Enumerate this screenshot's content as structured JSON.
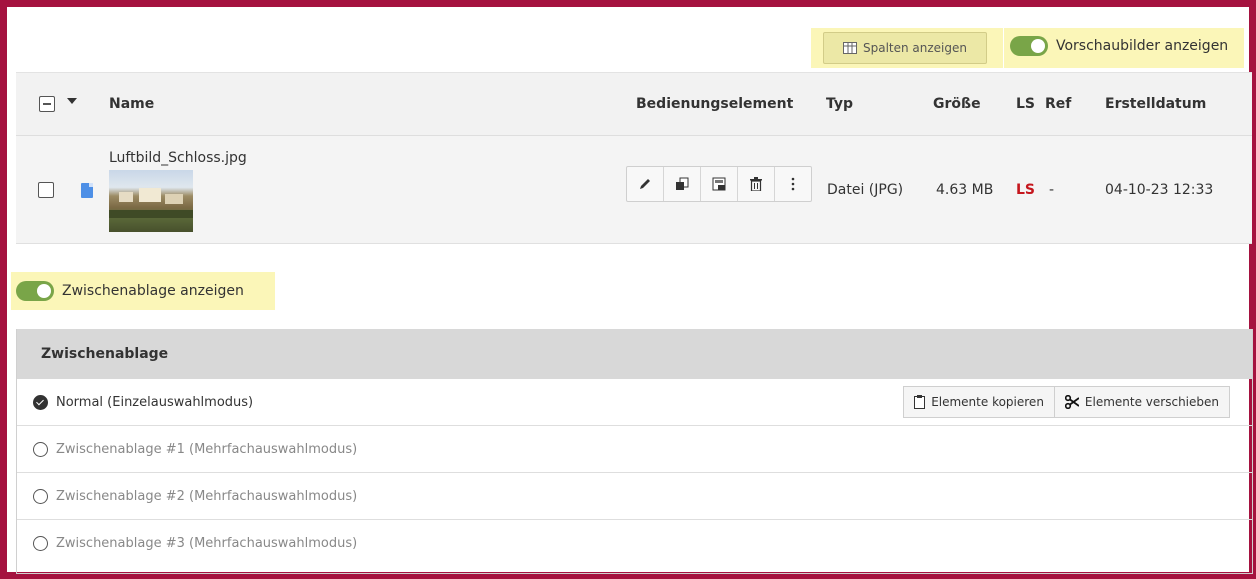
{
  "toolbar": {
    "columns_button": "Spalten anzeigen",
    "thumbnails_toggle": "Vorschaubilder anzeigen"
  },
  "table": {
    "headers": {
      "name": "Name",
      "controls": "Bedienungselement",
      "type": "Typ",
      "size": "Größe",
      "ls": "LS",
      "ref": "Ref",
      "created": "Erstelldatum"
    },
    "rows": [
      {
        "name": "Luftbild_Schloss.jpg",
        "type": "Datei (JPG)",
        "size": "4.63 MB",
        "ls": "LS",
        "ref": "-",
        "created": "04-10-23 12:33"
      }
    ]
  },
  "clipboard_toggle": "Zwischenablage anzeigen",
  "clipboard": {
    "title": "Zwischenablage",
    "modes": [
      "Normal (Einzelauswahlmodus)",
      "Zwischenablage #1 (Mehrfachauswahlmodus)",
      "Zwischenablage #2 (Mehrfachauswahlmodus)",
      "Zwischenablage #3 (Mehrfachauswahlmodus)"
    ],
    "copy_button": "Elemente kopieren",
    "move_button": "Elemente verschieben"
  },
  "colors": {
    "frame": "#a5123f",
    "highlight": "#fbf6b8",
    "toggle_on": "#79a548",
    "ls_red": "#c5161d",
    "file_icon": "#4d8fe6"
  }
}
